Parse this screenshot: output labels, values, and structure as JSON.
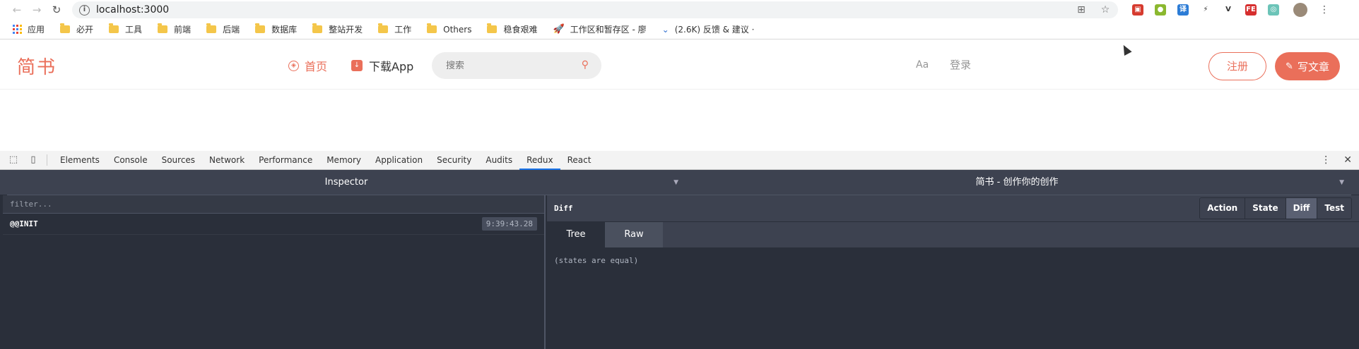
{
  "browser": {
    "url": "localhost:3000",
    "extensions": [
      {
        "icon": "ext-red-icon",
        "color": "#d63b2f",
        "glyph": "▣"
      },
      {
        "icon": "ext-chrome-like-icon",
        "color": "#8bb82f",
        "glyph": "●"
      },
      {
        "icon": "ext-translate-icon",
        "color": "#2c7cd6",
        "glyph": "译"
      },
      {
        "icon": "ext-bolt-icon",
        "color": "#ffffff",
        "glyph": "⚡"
      },
      {
        "icon": "ext-vue-icon",
        "color": "#ffffff",
        "glyph": "V"
      },
      {
        "icon": "ext-fe-icon",
        "color": "#d62e2e",
        "glyph": "FE"
      },
      {
        "icon": "ext-teal-icon",
        "color": "#6cc4b8",
        "glyph": "◎"
      }
    ],
    "bookmarks": [
      {
        "label": "应用",
        "type": "apps"
      },
      {
        "label": "必开",
        "type": "folder"
      },
      {
        "label": "工具",
        "type": "folder"
      },
      {
        "label": "前端",
        "type": "folder"
      },
      {
        "label": "后端",
        "type": "folder"
      },
      {
        "label": "数据库",
        "type": "folder"
      },
      {
        "label": "整站开发",
        "type": "folder"
      },
      {
        "label": "工作",
        "type": "folder"
      },
      {
        "label": "Others",
        "type": "folder"
      },
      {
        "label": "稳食艰难",
        "type": "folder"
      },
      {
        "label": "工作区和暂存区 - 廖",
        "type": "rocket"
      },
      {
        "label": "(2.6K) 反馈 & 建议 ·",
        "type": "chev"
      }
    ]
  },
  "site": {
    "logo": "简书",
    "nav_home": "首页",
    "nav_download": "下载App",
    "search_placeholder": "搜索",
    "font_toggle": "Aa",
    "login": "登录",
    "register": "注册",
    "write": "写文章",
    "accent": "#ea6f5a"
  },
  "devtools": {
    "tabs": [
      "Elements",
      "Console",
      "Sources",
      "Network",
      "Performance",
      "Memory",
      "Application",
      "Security",
      "Audits",
      "Redux",
      "React"
    ],
    "active_tab": "Redux"
  },
  "redux": {
    "monitor": "Inspector",
    "instance": "简书 - 创作你的创作",
    "filter_placeholder": "filter...",
    "actions": [
      {
        "name": "@@INIT",
        "time": "9:39:43.28"
      }
    ],
    "panel_title": "Diff",
    "modes": [
      "Action",
      "State",
      "Diff",
      "Test"
    ],
    "active_mode": "Diff",
    "subtabs": [
      "Tree",
      "Raw"
    ],
    "active_subtab": "Tree",
    "body_text": "(states are equal)"
  }
}
